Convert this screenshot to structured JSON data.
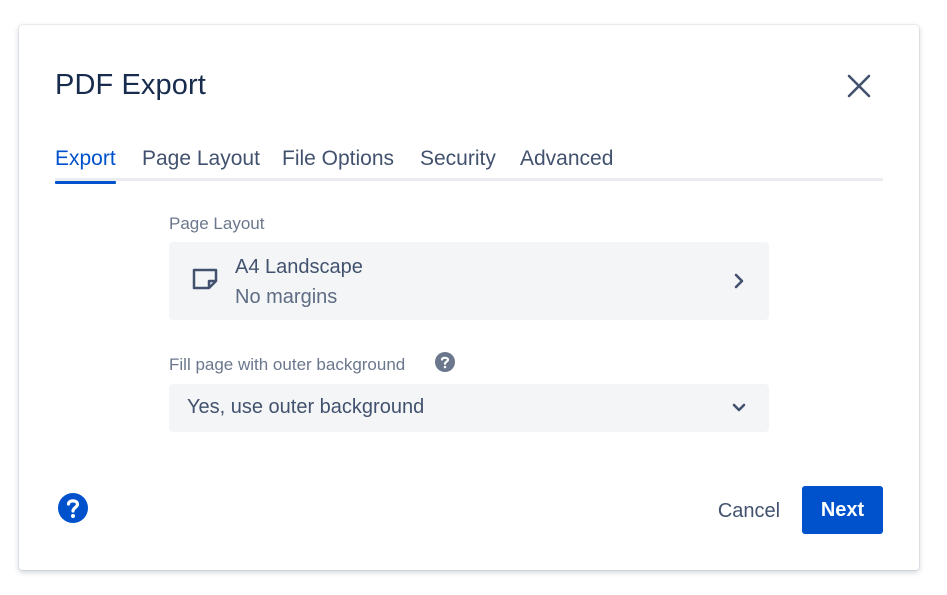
{
  "dialog": {
    "title": "PDF Export",
    "close_icon": "close-icon"
  },
  "tabs": [
    {
      "label": "Export",
      "active": true
    },
    {
      "label": "Page Layout",
      "active": false
    },
    {
      "label": "File Options",
      "active": false
    },
    {
      "label": "Security",
      "active": false
    },
    {
      "label": "Advanced",
      "active": false
    }
  ],
  "page_layout": {
    "label": "Page Layout",
    "name": "A4 Landscape",
    "subtitle": "No margins",
    "icon": "page-icon",
    "chevron_icon": "chevron-right-icon"
  },
  "background": {
    "label": "Fill page with outer background",
    "help_icon": "help-icon",
    "value": "Yes, use outer background",
    "chevron_icon": "chevron-down-icon"
  },
  "footer": {
    "help_icon": "help-icon",
    "cancel_label": "Cancel",
    "next_label": "Next"
  },
  "colors": {
    "primary": "#0052cc",
    "text": "#172b4d",
    "subtle_text": "#6b778c",
    "field_bg": "#f4f5f7"
  }
}
